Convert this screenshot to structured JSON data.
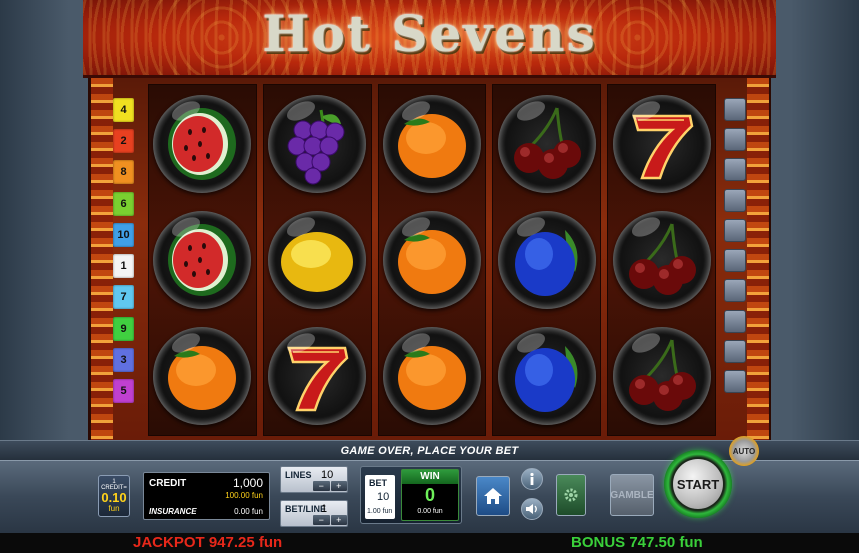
{
  "game": {
    "title": "Hot Sevens"
  },
  "reels": [
    [
      "watermelon",
      "watermelon",
      "orange"
    ],
    [
      "grapes",
      "lemon",
      "seven"
    ],
    [
      "orange",
      "orange",
      "orange"
    ],
    [
      "cherries",
      "plum",
      "plum"
    ],
    [
      "seven",
      "cherries",
      "cherries"
    ]
  ],
  "lines_left": [
    {
      "n": "4",
      "color": "#f0e020"
    },
    {
      "n": "2",
      "color": "#e84020"
    },
    {
      "n": "8",
      "color": "#f09020"
    },
    {
      "n": "6",
      "color": "#7ad030"
    },
    {
      "n": "10",
      "color": "#40a0e8"
    },
    {
      "n": "1",
      "color": "#f4f4f4"
    },
    {
      "n": "7",
      "color": "#60c8f0"
    },
    {
      "n": "9",
      "color": "#40d040"
    },
    {
      "n": "3",
      "color": "#6070e0"
    },
    {
      "n": "5",
      "color": "#c040d0"
    }
  ],
  "message": "GAME OVER, PLACE YOUR BET",
  "denomination": {
    "line1": "1 CREDIT=",
    "value": "0.10",
    "unit": "fun"
  },
  "credit": {
    "label": "CREDIT",
    "value": "1,000",
    "sub": "100.00 fun",
    "insurance_label": "INSURANCE",
    "insurance_value": "0.00 fun"
  },
  "lines": {
    "label": "LINES",
    "value": "10",
    "minus": "−",
    "plus": "+"
  },
  "bet_line": {
    "label": "BET/LINE",
    "value": "1",
    "minus": "−",
    "plus": "+"
  },
  "bet": {
    "label": "BET",
    "value": "10",
    "sub": "1.00 fun"
  },
  "win": {
    "label": "WIN",
    "value": "0",
    "sub": "0.00 fun"
  },
  "buttons": {
    "gamble": "GAMBLE",
    "start": "START",
    "auto": "AUTO"
  },
  "footer": {
    "jackpot": "JACKPOT 947.25 fun",
    "bonus": "BONUS 747.50 fun"
  }
}
